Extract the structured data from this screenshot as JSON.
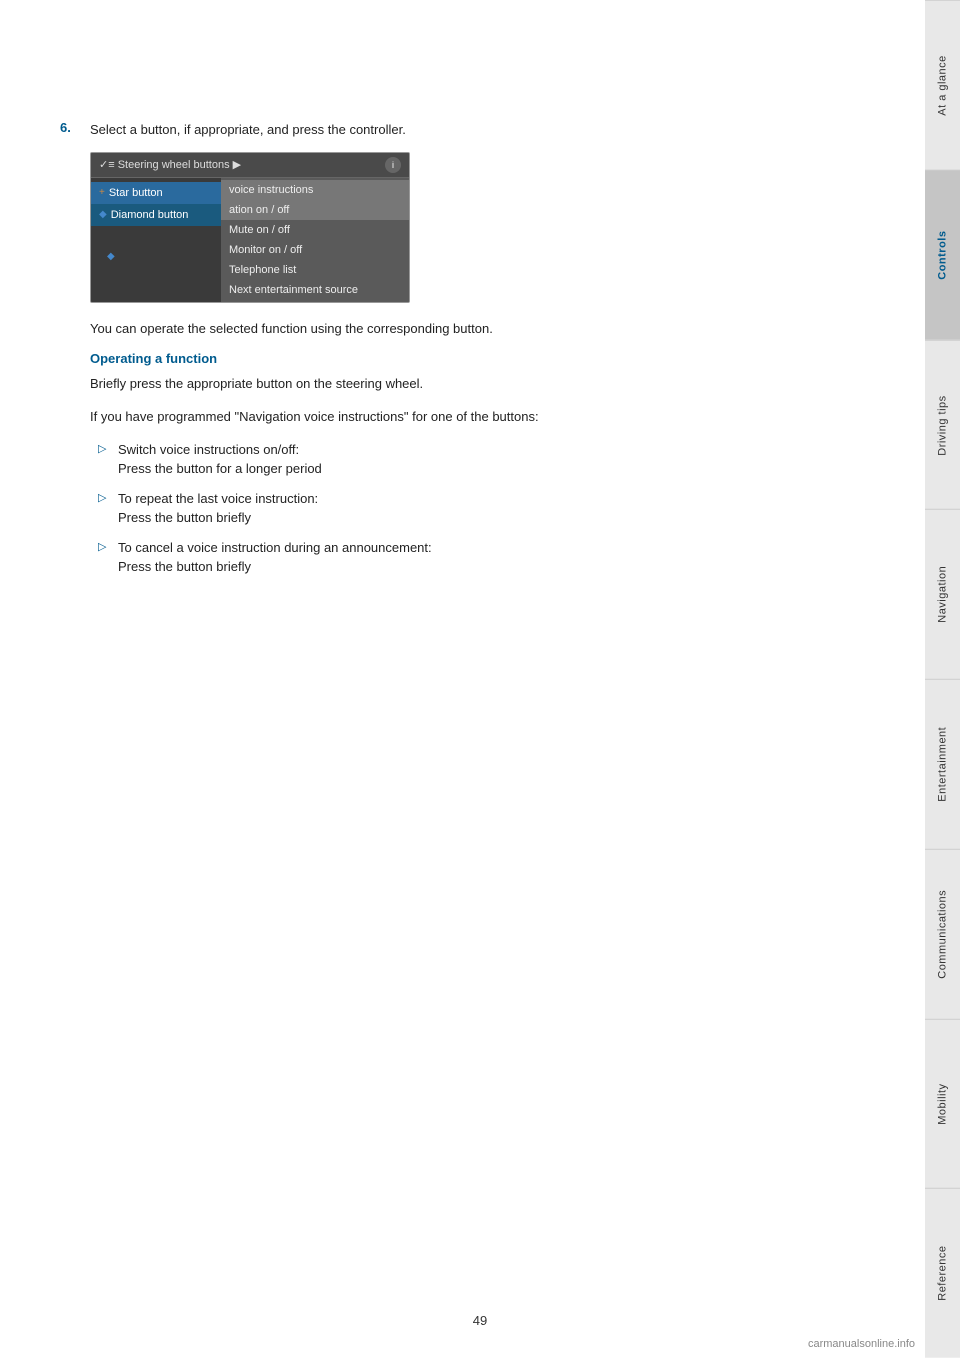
{
  "page": {
    "number": "49",
    "watermark": "carmanualsonline.info"
  },
  "step6": {
    "number": "6.",
    "text": "Select a button, if appropriate, and press the controller."
  },
  "ui_mockup": {
    "header": "✓≡ Steering wheel buttons ▶",
    "sidebar_items": [
      {
        "icon": "+",
        "label": "Star button",
        "style": "highlight"
      },
      {
        "icon": "◆",
        "label": "Diamond button",
        "style": "alt-highlight"
      },
      {
        "icon": "",
        "label": "",
        "style": "normal"
      },
      {
        "icon": "◆",
        "label": "",
        "style": "normal"
      }
    ],
    "menu_items": [
      "voice instructions",
      "ation on / off",
      "Mute on / off",
      "Monitor on / off",
      "Telephone list",
      "Next entertainment source"
    ]
  },
  "para1": "You can operate the selected function using the corresponding button.",
  "section_heading": "Operating a function",
  "para2": "Briefly press the appropriate button on the steering wheel.",
  "para3": "If you have programmed \"Navigation voice instructions\" for one of the buttons:",
  "bullets": [
    {
      "main": "Switch voice instructions on/off:",
      "sub": "Press the button for a longer period"
    },
    {
      "main": "To repeat the last voice instruction:",
      "sub": "Press the button briefly"
    },
    {
      "main": "To cancel a voice instruction during an announcement:",
      "sub": "Press the button briefly"
    }
  ],
  "tabs": [
    {
      "label": "At a glance",
      "active": false
    },
    {
      "label": "Controls",
      "active": true
    },
    {
      "label": "Driving tips",
      "active": false
    },
    {
      "label": "Navigation",
      "active": false
    },
    {
      "label": "Entertainment",
      "active": false
    },
    {
      "label": "Communications",
      "active": false
    },
    {
      "label": "Mobility",
      "active": false
    },
    {
      "label": "Reference",
      "active": false
    }
  ]
}
